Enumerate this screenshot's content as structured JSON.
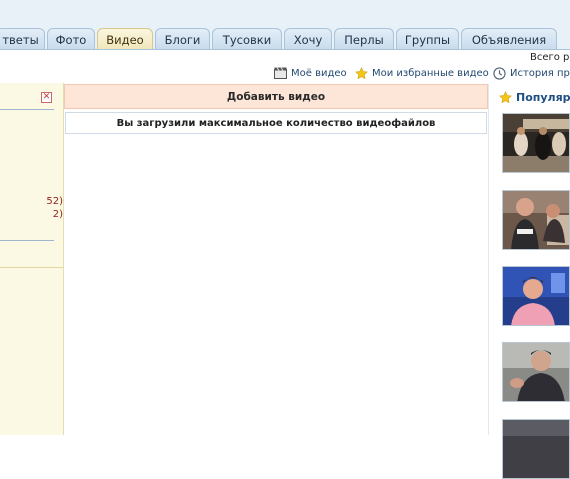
{
  "tabs": [
    {
      "label": "тветы",
      "active": false
    },
    {
      "label": "Фото",
      "active": false
    },
    {
      "label": "Видео",
      "active": true
    },
    {
      "label": "Блоги",
      "active": false
    },
    {
      "label": "Тусовки",
      "active": false
    },
    {
      "label": "Хочу",
      "active": false
    },
    {
      "label": "Перлы",
      "active": false
    },
    {
      "label": "Группы",
      "active": false
    },
    {
      "label": "Объявления",
      "active": false
    }
  ],
  "header": {
    "total_label": "Всего ре"
  },
  "sublinks": [
    {
      "label": "Моё видео",
      "icon": "film-icon"
    },
    {
      "label": "Мои избранные видео",
      "icon": "star-icon"
    },
    {
      "label": "История про",
      "icon": "clock-icon"
    }
  ],
  "left_panel": {
    "close_glyph": "✕",
    "counts": [
      "52)",
      "2)"
    ]
  },
  "main": {
    "add_video_label": "Добавить видео",
    "limit_message": "Вы загрузили максимальное количество видеофайлов"
  },
  "popular": {
    "title": "Популярн",
    "icon": "star-icon",
    "thumbnails": [
      "video-thumbnail-1",
      "video-thumbnail-2",
      "video-thumbnail-3",
      "video-thumbnail-4",
      "video-thumbnail-5"
    ]
  },
  "colors": {
    "tab_bg": "#c8dbec",
    "tab_active_bg": "#f1e6b9",
    "add_bar_bg": "#fde6d7",
    "left_panel_bg": "#fbf9e4",
    "link_color": "#234a72",
    "popular_title_color": "#1d4f83"
  }
}
